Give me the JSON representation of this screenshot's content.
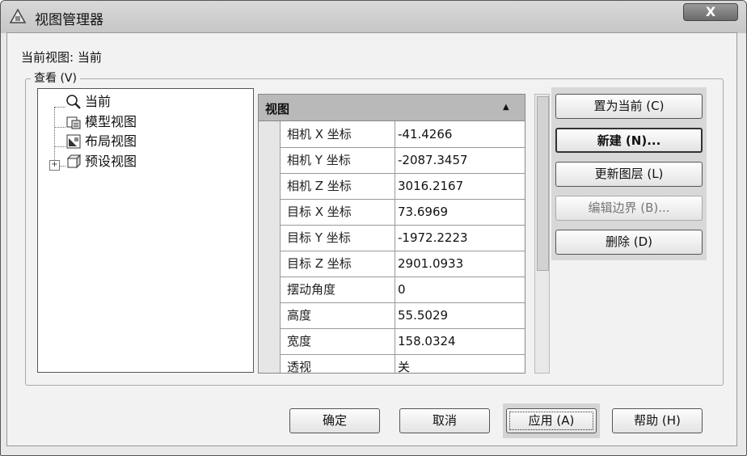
{
  "window": {
    "title": "视图管理器",
    "close_label": "X"
  },
  "current_view": {
    "label": "当前视图:",
    "value": "当前"
  },
  "view_group": {
    "label": "查看 (V)"
  },
  "tree": {
    "items": [
      {
        "label": "当前",
        "icon": "magnifier-icon"
      },
      {
        "label": "模型视图",
        "icon": "model-view-icon"
      },
      {
        "label": "布局视图",
        "icon": "layout-view-icon"
      },
      {
        "label": "预设视图",
        "icon": "preset-view-icon",
        "expander": "⊞"
      }
    ]
  },
  "properties": {
    "header": "视图",
    "collapse_glyph": "▲",
    "rows": [
      {
        "name": "相机 X 坐标",
        "value": "-41.4266"
      },
      {
        "name": "相机 Y 坐标",
        "value": "-2087.3457"
      },
      {
        "name": "相机 Z 坐标",
        "value": "3016.2167"
      },
      {
        "name": "目标 X 坐标",
        "value": "73.6969"
      },
      {
        "name": "目标 Y 坐标",
        "value": "-1972.2223"
      },
      {
        "name": "目标 Z 坐标",
        "value": "2901.0933"
      },
      {
        "name": "摆动角度",
        "value": "0"
      },
      {
        "name": "高度",
        "value": "55.5029"
      },
      {
        "name": "宽度",
        "value": "158.0324"
      },
      {
        "name": "透视",
        "value": "关"
      }
    ]
  },
  "side_buttons": {
    "set_current": "置为当前 (C)",
    "new": "新建 (N)...",
    "update_layers": "更新图层 (L)",
    "edit_boundaries": "编辑边界 (B)...",
    "delete": "删除 (D)"
  },
  "footer_buttons": {
    "ok": "确定",
    "cancel": "取消",
    "apply": "应用 (A)",
    "help": "帮助 (H)"
  }
}
